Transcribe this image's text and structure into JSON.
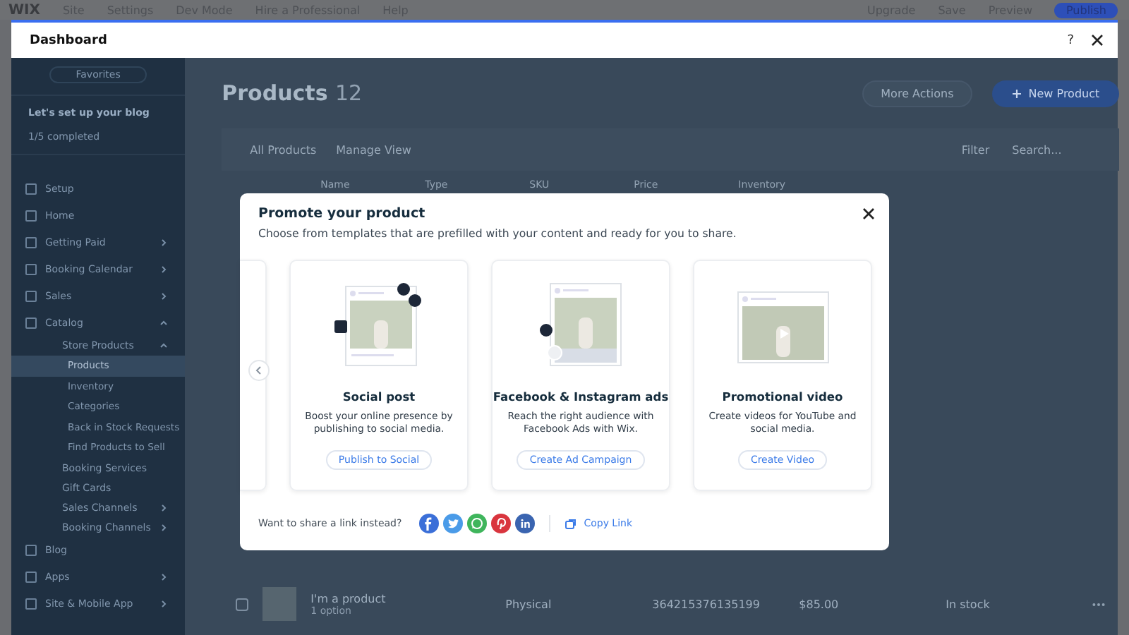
{
  "editor_bar": {
    "logo": "WIX",
    "menu": [
      "Site",
      "Settings",
      "Dev Mode",
      "Hire a Professional",
      "Help"
    ],
    "actions": [
      "Upgrade",
      "Save",
      "Preview"
    ],
    "publish": "Publish"
  },
  "window": {
    "title": "Dashboard",
    "help": "?"
  },
  "sidebar": {
    "favorites": "Favorites",
    "setup_title": "Let's set up your blog",
    "setup_progress": "1/5 completed",
    "items": [
      {
        "label": "Setup",
        "expandable": false,
        "selected": false
      },
      {
        "label": "Home",
        "expandable": false,
        "selected": false
      },
      {
        "label": "Getting Paid",
        "expandable": true,
        "expanded": false,
        "selected": false
      },
      {
        "label": "Booking Calendar",
        "expandable": true,
        "expanded": false,
        "selected": false
      },
      {
        "label": "Sales",
        "expandable": true,
        "expanded": false,
        "selected": false
      },
      {
        "label": "Catalog",
        "expandable": true,
        "expanded": true,
        "selected": false,
        "children": [
          {
            "label": "Store Products",
            "expandable": true,
            "expanded": true,
            "selected": false,
            "children": [
              {
                "label": "Products",
                "expandable": false,
                "selected": true
              },
              {
                "label": "Inventory",
                "expandable": false,
                "selected": false
              },
              {
                "label": "Categories",
                "expandable": false,
                "selected": false
              },
              {
                "label": "Back in Stock Requests",
                "expandable": false,
                "selected": false
              },
              {
                "label": "Find Products to Sell",
                "expandable": false,
                "selected": false
              }
            ]
          },
          {
            "label": "Booking Services",
            "expandable": false,
            "selected": false
          },
          {
            "label": "Gift Cards",
            "expandable": false,
            "selected": false
          },
          {
            "label": "Sales Channels",
            "expandable": true,
            "expanded": false,
            "selected": false
          },
          {
            "label": "Booking Channels",
            "expandable": true,
            "expanded": false,
            "selected": false
          }
        ]
      },
      {
        "label": "Blog",
        "expandable": false,
        "selected": false
      },
      {
        "label": "Apps",
        "expandable": true,
        "expanded": false,
        "selected": false
      },
      {
        "label": "Site & Mobile App",
        "expandable": true,
        "expanded": false,
        "selected": false
      }
    ]
  },
  "page": {
    "title": "Products",
    "count": "12",
    "more_actions": "More Actions",
    "new_product": "New Product",
    "toolbar": {
      "collection": "All Products",
      "view": "Manage View",
      "filter": "Filter",
      "search_placeholder": "Search..."
    },
    "table": {
      "columns": [
        "Name",
        "Type",
        "SKU",
        "Price",
        "Inventory"
      ],
      "rows": [
        {
          "checked": false,
          "name": "I'm a product",
          "variant": "1 option",
          "type": "Physical",
          "sku": "364215376135199",
          "price": "$85.00",
          "inventory": "In stock"
        }
      ]
    }
  },
  "modal": {
    "title": "Promote your product",
    "subtitle": "Choose from templates that are prefilled with your content and ready for you to share.",
    "cards": [
      {
        "kind": "social",
        "title": "Social post",
        "description": "Boost your online presence by publishing to social media.",
        "action": "Publish to Social"
      },
      {
        "kind": "ads",
        "title": "Facebook & Instagram ads",
        "description": "Reach the right audience with Facebook Ads with Wix.",
        "action": "Create Ad Campaign"
      },
      {
        "kind": "video",
        "title": "Promotional video",
        "description": "Create videos for YouTube and social media.",
        "action": "Create Video"
      }
    ],
    "share_prompt": "Want to share a link instead?",
    "share": [
      {
        "kind": "facebook",
        "color": "#3b6fd8"
      },
      {
        "kind": "twitter",
        "color": "#4a9be8"
      },
      {
        "kind": "whatsapp",
        "color": "#3fb55c"
      },
      {
        "kind": "pinterest",
        "color": "#d9353e"
      },
      {
        "kind": "linkedin",
        "color": "#3a64b0"
      }
    ],
    "copy_link": "Copy Link"
  }
}
